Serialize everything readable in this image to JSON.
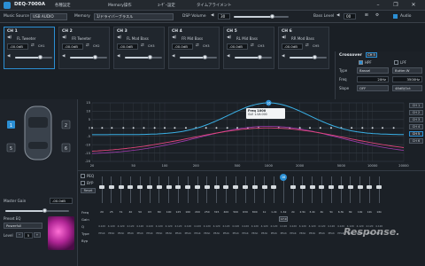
{
  "app": {
    "title": "DEQ-7000A"
  },
  "menu": [
    "各種設定",
    "Memory操作",
    "ﾕｰｻﾞｰ設定",
    "タイムアライメント"
  ],
  "toolbar": {
    "music_source_label": "Music Source",
    "music_source_value": "USB AUDIO",
    "memory_label": "Memory",
    "memory_value": "1/ドライバーブラスル",
    "dsp_volume_label": "DSP Volume",
    "dsp_volume_value": "30",
    "bass_level_label": "Bass Level",
    "bass_level_value": "00",
    "audio_label": "Audio"
  },
  "channels": [
    {
      "num": "CH 1",
      "name": "FL Tweeter",
      "value": "-00.0dB",
      "tag": "CH1"
    },
    {
      "num": "CH 2",
      "name": "FR Tweeter",
      "value": "-00.0dB",
      "tag": "CH2"
    },
    {
      "num": "CH 3",
      "name": "FL Mod Bass",
      "value": "-00.0dB",
      "tag": "CH3"
    },
    {
      "num": "CH 4",
      "name": "FR Mid Bass",
      "value": "-00.0dB",
      "tag": "CH3"
    },
    {
      "num": "CH 5",
      "name": "RL Mid Bass",
      "value": "-00.0dB",
      "tag": "CH3"
    },
    {
      "num": "CH 6",
      "name": "RR Mod Bass",
      "value": "-00.0dB",
      "tag": "CH5"
    }
  ],
  "crossover": {
    "title": "Crossover",
    "ch": "CH 5",
    "hpf_label": "HPF",
    "lpf_label": "LPF",
    "type_label": "Type",
    "type_hpf": "Bassel",
    "type_lpf": "Butter.W",
    "freq_label": "Freq",
    "freq_hpf": "20Hz",
    "freq_lpf": "3500Hz",
    "slope_label": "Slope",
    "slope_hpf": "OFF",
    "slope_lpf": "48dB/Oct"
  },
  "graph": {
    "tooltip_line1": "Freq 1000",
    "tooltip_line2": "GLE 1.0A 000",
    "y_ticks": [
      "15",
      "10",
      "5",
      "0",
      "-5",
      "-10",
      "-15",
      "-20"
    ],
    "x_ticks": [
      "20",
      "50",
      "100",
      "200",
      "500",
      "1000",
      "2000",
      "5000",
      "10000",
      "20000"
    ],
    "legend": [
      "CH 1",
      "CH 2",
      "CH 3",
      "CH 4",
      "CH 5",
      "CH 6"
    ],
    "marker": "16"
  },
  "eq": {
    "peq_label": "PEQ",
    "byp_label": "BYP",
    "reset_label": "Reset",
    "row_labels": [
      "Freq",
      "Gain",
      "Q",
      "Type",
      "Byp"
    ],
    "active_band": "16",
    "active_gain": "17.0",
    "freq_cells": [
      "20",
      "25",
      "31",
      "40",
      "50",
      "63",
      "80",
      "100",
      "125",
      "160",
      "200",
      "250",
      "315",
      "400",
      "500",
      "630",
      "800",
      "1k",
      "1.2k",
      "1.6k",
      "2k",
      "2.5k",
      "3.2k",
      "4k",
      "5k",
      "6.3k",
      "8k",
      "10k",
      "12k",
      "16k"
    ],
    "q_value": "4.120",
    "type_value": "PEAK",
    "byp_value": "0"
  },
  "left": {
    "master_gain_label": "Master Gain",
    "master_gain_value": "-00.0dB",
    "preset_label": "Preset EQ",
    "preset_value": "Powerfull",
    "level_label": "Level",
    "level_value": "5"
  },
  "colors": {
    "accent": "#2b8fd4",
    "curve_pink": "#e0457b",
    "curve_blue": "#3ab0e6",
    "curve_purple": "#a03bb0"
  },
  "watermark": "Response."
}
